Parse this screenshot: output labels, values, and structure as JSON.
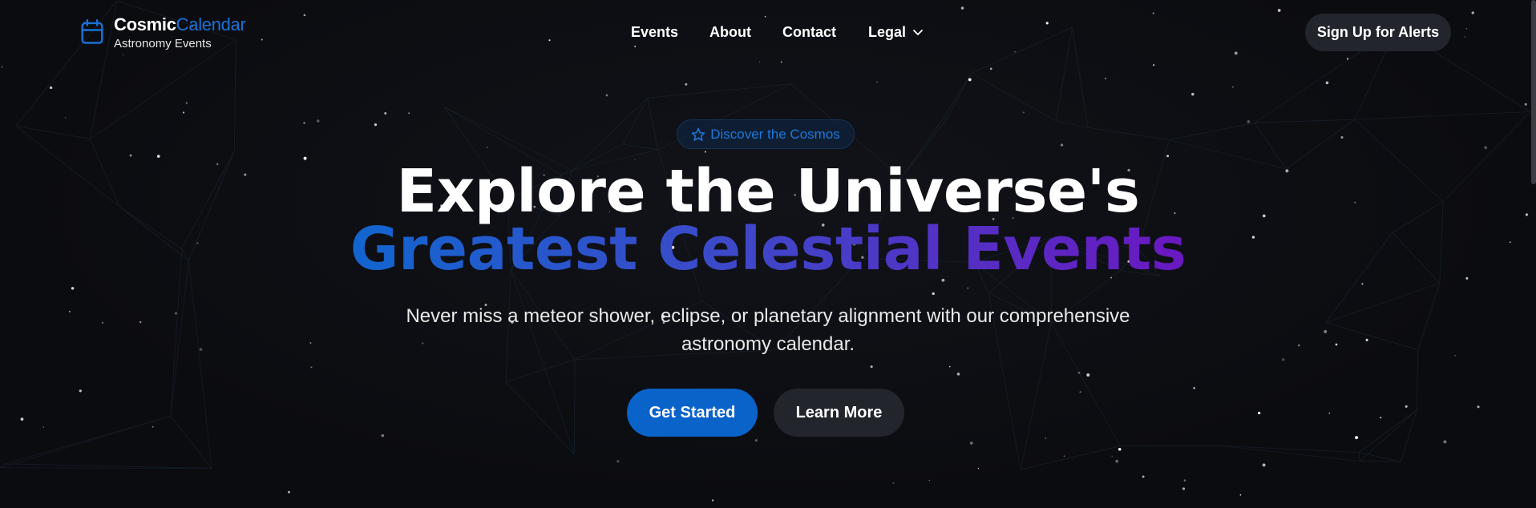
{
  "brand": {
    "name_part1": "Cosmic",
    "name_part2": "Calendar",
    "tagline": "Astronomy Events",
    "icon": "calendar-icon",
    "accent_color": "#1a72d6"
  },
  "nav": {
    "items": [
      {
        "label": "Events"
      },
      {
        "label": "About"
      },
      {
        "label": "Contact"
      },
      {
        "label": "Legal",
        "icon": "chevron-down-icon"
      }
    ]
  },
  "header_cta": {
    "label": "Sign Up for Alerts"
  },
  "hero": {
    "badge": {
      "icon": "star-icon",
      "label": "Discover the Cosmos"
    },
    "title_line1": "Explore the Universe's",
    "title_line2": "Greatest Celestial Events",
    "subtitle": "Never miss a meteor shower, eclipse, or planetary alignment with our comprehensive astronomy calendar.",
    "primary_button": "Get Started",
    "secondary_button": "Learn More"
  },
  "colors": {
    "background": "#0b0c10",
    "primary": "#0a63c9",
    "secondary": "#22252c",
    "gradient_start": "#1265cf",
    "gradient_end": "#6a18c0"
  }
}
